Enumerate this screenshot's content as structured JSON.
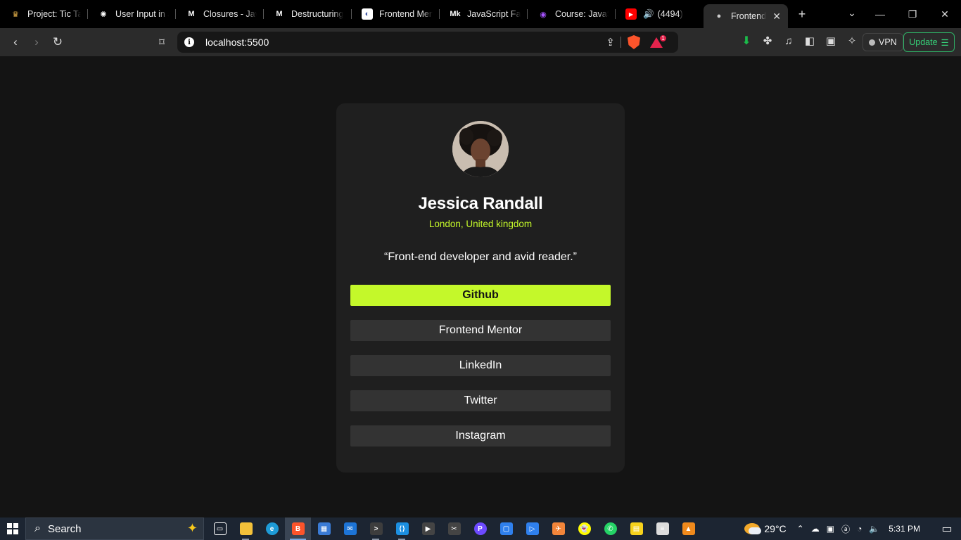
{
  "browser": {
    "tabs": [
      {
        "title": "Project: Tic Tac",
        "icon": "odin-project-icon",
        "color": "#e9b44c"
      },
      {
        "title": "User Input in J",
        "icon": "openai-icon",
        "color": "#ffffff"
      },
      {
        "title": "Closures - Java",
        "icon": "medium-icon",
        "color": "#ffffff"
      },
      {
        "title": "Destructuring",
        "icon": "medium-icon",
        "color": "#ffffff"
      },
      {
        "title": "Frontend Men",
        "icon": "frontend-mentor-icon",
        "color": "#ffffff"
      },
      {
        "title": "JavaScript Fac",
        "icon": "medium-mk-icon",
        "color": "#ffffff"
      },
      {
        "title": "Course: JavaSc",
        "icon": "course-icon",
        "color": "#a653ff"
      },
      {
        "title": "(4494)",
        "icon": "youtube-icon",
        "color": "#ff0000"
      },
      {
        "title": "Frontend",
        "icon": "globe-icon",
        "color": "#cccccc",
        "active": true
      }
    ],
    "new_tab_symbol": "+",
    "url": "localhost:5500",
    "vpn_label": "VPN",
    "update_label": "Update",
    "rewards_badge": "1"
  },
  "profile": {
    "name": "Jessica Randall",
    "location": "London, United kingdom",
    "bio": "“Front-end developer and avid reader.”",
    "links": [
      {
        "label": "Github",
        "primary": true
      },
      {
        "label": "Frontend Mentor",
        "primary": false
      },
      {
        "label": "LinkedIn",
        "primary": false
      },
      {
        "label": "Twitter",
        "primary": false
      },
      {
        "label": "Instagram",
        "primary": false
      }
    ],
    "accent_color": "#c4f82a",
    "card_color": "#1f1f1f",
    "button_color": "#333333"
  },
  "taskbar": {
    "search_label": "Search",
    "temperature": "29°C",
    "time": "5:31 PM",
    "apps": [
      {
        "name": "task-view",
        "color": "#1c2532",
        "glyph": "▭"
      },
      {
        "name": "file-explorer",
        "color": "#f3c13a",
        "glyph": ""
      },
      {
        "name": "edge",
        "color": "#1e9bd7",
        "glyph": "e"
      },
      {
        "name": "brave",
        "color": "#fb542b",
        "glyph": "B",
        "active": true
      },
      {
        "name": "microsoft-store",
        "color": "#3a7bd5",
        "glyph": "▦"
      },
      {
        "name": "mail",
        "color": "#1d74d6",
        "glyph": "✉"
      },
      {
        "name": "terminal",
        "color": "#3d3d3d",
        "glyph": ">"
      },
      {
        "name": "vscode",
        "color": "#1c8fe0",
        "glyph": "⟨⟩"
      },
      {
        "name": "clipchamp",
        "color": "#444444",
        "glyph": "▶"
      },
      {
        "name": "snipping-tool",
        "color": "#444444",
        "glyph": "✂"
      },
      {
        "name": "proton",
        "color": "#6d4aff",
        "glyph": "P"
      },
      {
        "name": "app-blue",
        "color": "#2f80ed",
        "glyph": "▢"
      },
      {
        "name": "app-remote",
        "color": "#2f80ed",
        "glyph": "▷"
      },
      {
        "name": "app-orange",
        "color": "#f2853a",
        "glyph": "✈"
      },
      {
        "name": "snapchat",
        "color": "#fffc00",
        "glyph": "👻"
      },
      {
        "name": "whatsapp",
        "color": "#25d366",
        "glyph": "✆"
      },
      {
        "name": "sticky-notes",
        "color": "#f7d21c",
        "glyph": "▤"
      },
      {
        "name": "notepad",
        "color": "#dddddd",
        "glyph": "≡"
      },
      {
        "name": "vlc",
        "color": "#f08a1c",
        "glyph": "▲"
      }
    ]
  }
}
